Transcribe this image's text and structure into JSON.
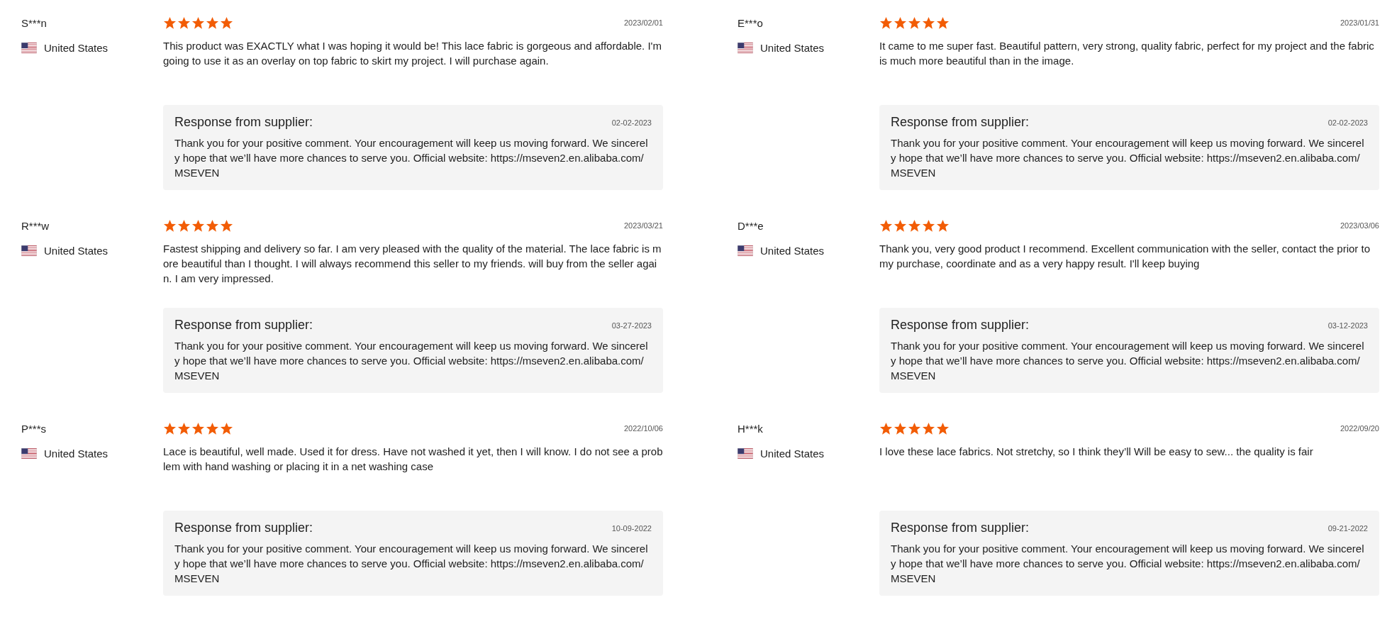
{
  "columns": [
    {
      "reviews": [
        {
          "reviewer": "S***n",
          "country": "United States",
          "stars": 5,
          "date": "2023/02/01",
          "text": "This product was EXACTLY what I was hoping it would be! This lace fabric is gorgeous and affordable. I'm going to use it as an overlay on top fabric to skirt my project. I will purchase again.",
          "response": {
            "title": "Response from supplier:",
            "date": "02-02-2023",
            "text": "Thank you for your positive comment. Your encouragement will keep us moving forward. We sincerely hope that we’ll have more chances to serve you. Official website: https://mseven2.en.alibaba.com/ MSEVEN"
          }
        },
        {
          "reviewer": "R***w",
          "country": "United States",
          "stars": 5,
          "date": "2023/03/21",
          "text": "Fastest shipping and delivery so far. I am very pleased with the quality of the material. The lace fabric is more beautiful than I thought. I will always recommend this seller to my friends. will buy from the seller again. I am very impressed.",
          "response": {
            "title": "Response from supplier:",
            "date": "03-27-2023",
            "text": "Thank you for your positive comment. Your encouragement will keep us moving forward. We sincerely hope that we’ll have more chances to serve you. Official website: https://mseven2.en.alibaba.com/ MSEVEN"
          }
        },
        {
          "reviewer": "P***s",
          "country": "United States",
          "stars": 5,
          "date": "2022/10/06",
          "text": "Lace is beautiful, well made. Used it for dress. Have not washed it yet, then I will know. I do not see a problem with hand washing or placing it in a net washing case",
          "response": {
            "title": "Response from supplier:",
            "date": "10-09-2022",
            "text": "Thank you for your positive comment. Your encouragement will keep us moving forward. We sincerely hope that we’ll have more chances to serve you. Official website: https://mseven2.en.alibaba.com/ MSEVEN"
          }
        }
      ]
    },
    {
      "reviews": [
        {
          "reviewer": "E***o",
          "country": "United States",
          "stars": 5,
          "date": "2023/01/31",
          "text": "It came to me super fast. Beautiful pattern, very strong, quality fabric, perfect for my project and the fabric is much more beautiful than in the image.",
          "response": {
            "title": "Response from supplier:",
            "date": "02-02-2023",
            "text": "Thank you for your positive comment. Your encouragement will keep us moving forward. We sincerely hope that we’ll have more chances to serve you. Official website: https://mseven2.en.alibaba.com/ MSEVEN"
          }
        },
        {
          "reviewer": "D***e",
          "country": "United States",
          "stars": 5,
          "date": "2023/03/06",
          "text": "Thank you, very good product I recommend. Excellent communication with the seller, contact the prior to my purchase, coordinate and as a very happy result. I'll keep buying",
          "response": {
            "title": "Response from supplier:",
            "date": "03-12-2023",
            "text": "Thank you for your positive comment. Your encouragement will keep us moving forward. We sincerely hope that we’ll have more chances to serve you. Official website: https://mseven2.en.alibaba.com/ MSEVEN"
          }
        },
        {
          "reviewer": "H***k",
          "country": "United States",
          "stars": 5,
          "date": "2022/09/20",
          "text": "I love these lace fabrics. Not stretchy, so I think they’ll Will be easy to sew... the quality is fair",
          "response": {
            "title": "Response from supplier:",
            "date": "09-21-2022",
            "text": "Thank you for your positive comment. Your encouragement will keep us moving forward. We sincerely hope that we’ll have more chances to serve you. Official website: https://mseven2.en.alibaba.com/ MSEVEN"
          }
        }
      ]
    }
  ]
}
